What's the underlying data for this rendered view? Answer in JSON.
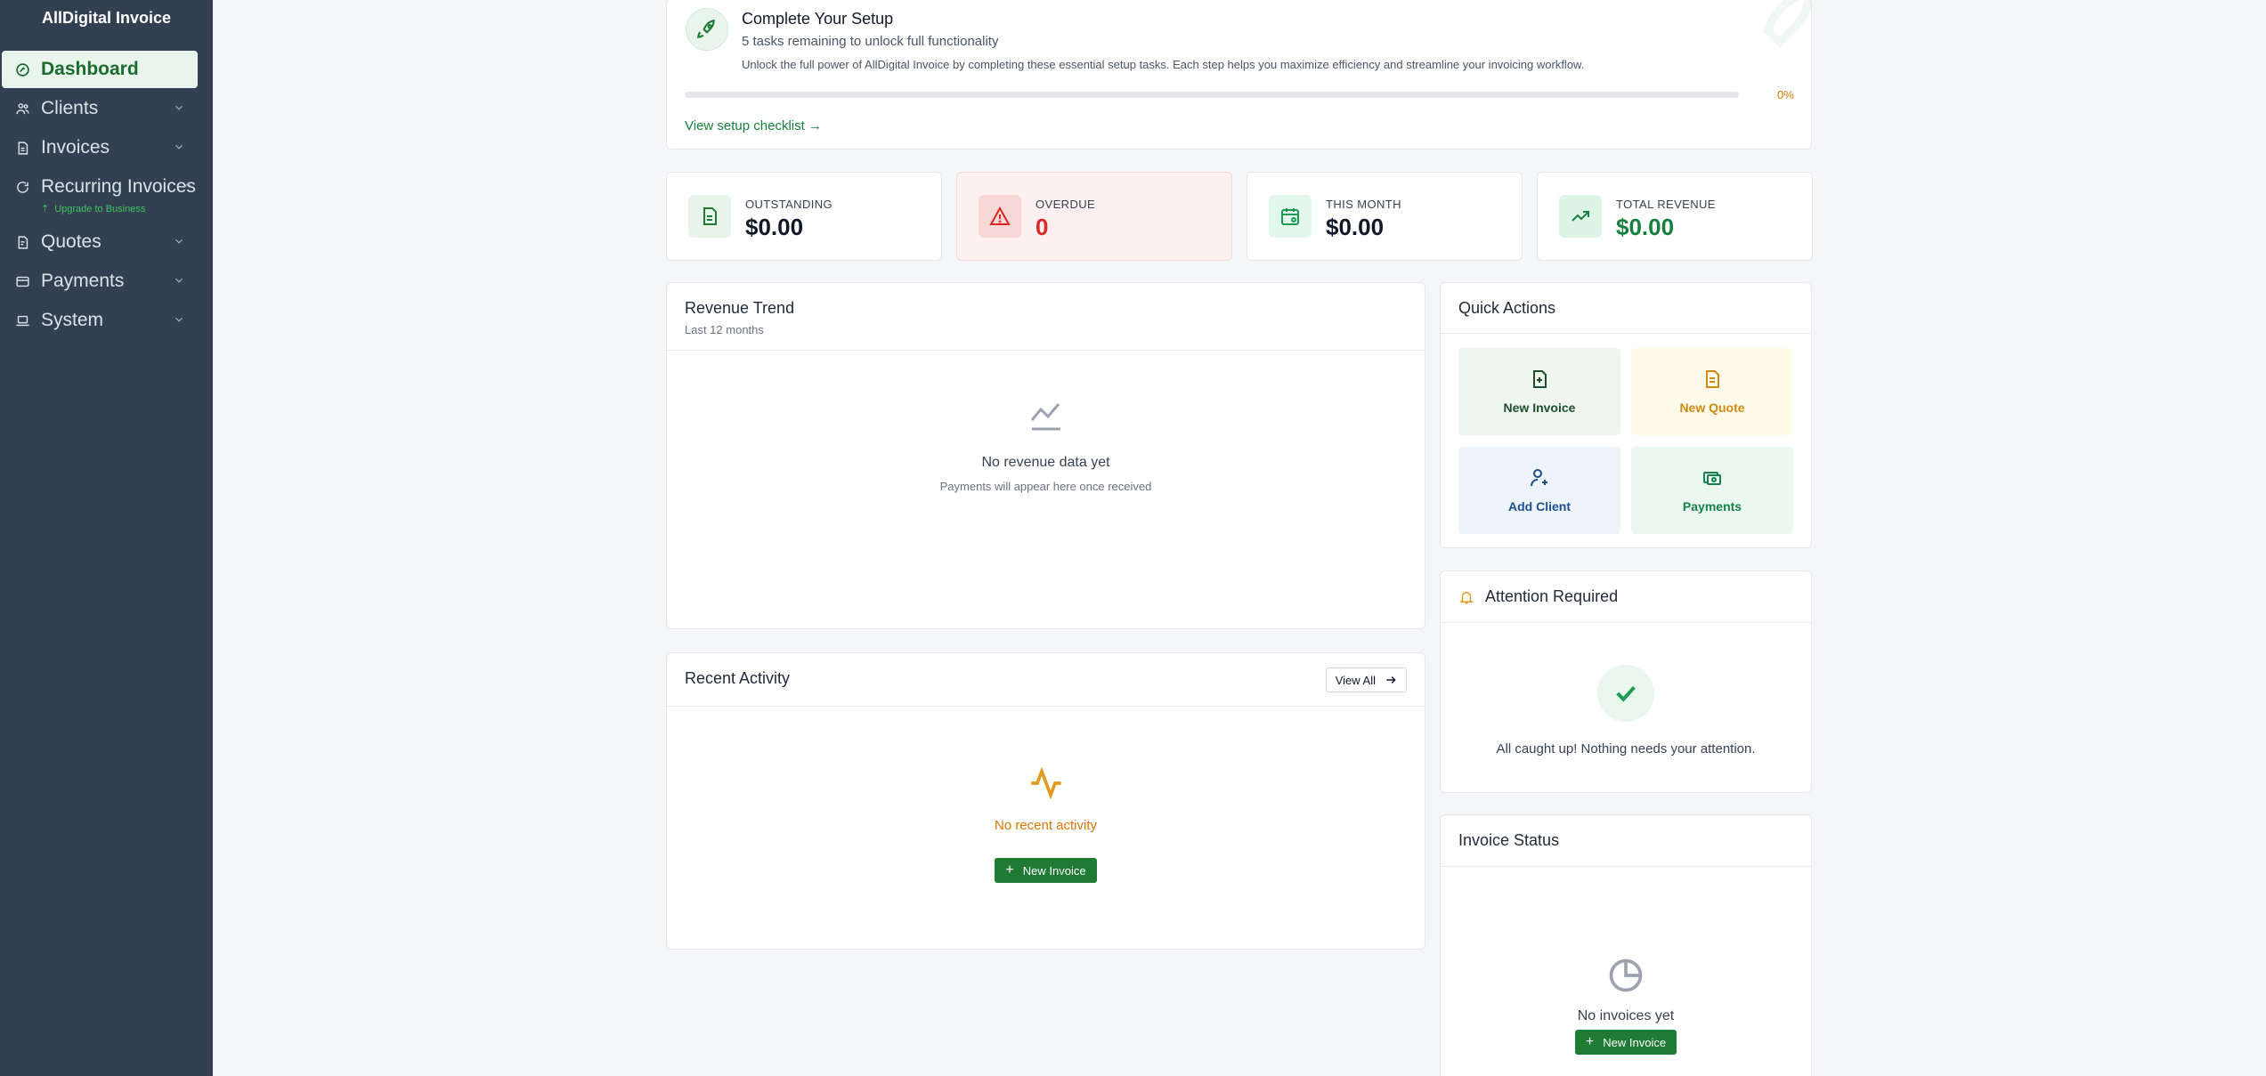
{
  "app": {
    "brand": "AllDigital Invoice"
  },
  "sidebar": {
    "items": [
      {
        "label": "Dashboard",
        "icon": "dashboard-icon"
      },
      {
        "label": "Clients",
        "icon": "users-icon"
      },
      {
        "label": "Invoices",
        "icon": "document-icon"
      },
      {
        "label": "Recurring Invoices",
        "icon": "refresh-icon",
        "sublabel": "Upgrade to Business"
      },
      {
        "label": "Quotes",
        "icon": "quote-icon"
      },
      {
        "label": "Payments",
        "icon": "credit-card-icon"
      },
      {
        "label": "System",
        "icon": "laptop-icon"
      }
    ]
  },
  "setup": {
    "title": "Complete Your Setup",
    "subtitle": "5 tasks remaining to unlock full functionality",
    "description": "Unlock the full power of AllDigital Invoice by completing these essential setup tasks. Each step helps you maximize efficiency and streamline your invoicing workflow.",
    "progress_percent": 0,
    "progress_label": "0%",
    "link": "View setup checklist →"
  },
  "stats": [
    {
      "label": "OUTSTANDING",
      "value": "$0.00"
    },
    {
      "label": "OVERDUE",
      "value": "0"
    },
    {
      "label": "THIS MONTH",
      "value": "$0.00"
    },
    {
      "label": "TOTAL REVENUE",
      "value": "$0.00"
    }
  ],
  "revenue": {
    "title": "Revenue Trend",
    "subtitle": "Last 12 months",
    "empty_title": "No revenue data yet",
    "empty_sub": "Payments will appear here once received"
  },
  "quick_actions": {
    "title": "Quick Actions",
    "items": [
      {
        "label": "New Invoice"
      },
      {
        "label": "New Quote"
      },
      {
        "label": "Add Client"
      },
      {
        "label": "Payments"
      }
    ]
  },
  "attention": {
    "title": "Attention Required",
    "message": "All caught up! Nothing needs your attention."
  },
  "activity": {
    "title": "Recent Activity",
    "view_all": "View All",
    "empty_title": "No recent activity",
    "button": "New Invoice"
  },
  "invoice_status": {
    "title": "Invoice Status",
    "empty_title": "No invoices yet",
    "button": "New Invoice"
  },
  "colors": {
    "sidebar": "#324052",
    "accent_green": "#1f7a34",
    "danger": "#dc2626",
    "warning": "#d97706",
    "revenue_green": "#15803d"
  }
}
